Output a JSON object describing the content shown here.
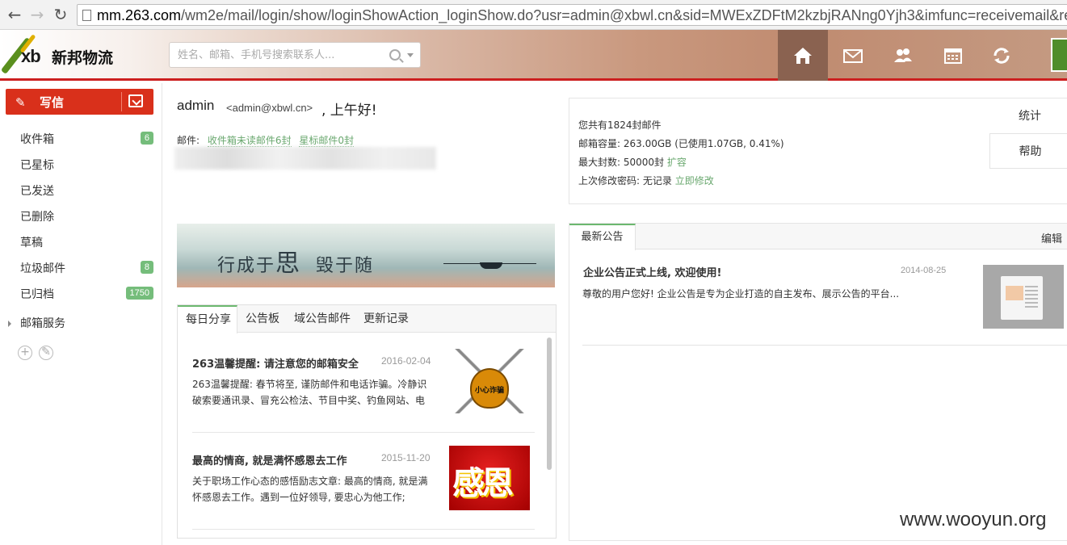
{
  "browser": {
    "url_host": "mm.263.com",
    "url_path": "/wm2e/mail/login/show/loginShowAction_loginShow.do?usr=admin@xbwl.cn&sid=MWExZDFtM2kzbjRANng0Yjh3&imfunc=receivemail&rece"
  },
  "header": {
    "logo_mark": "xb",
    "logo_name": "新邦物流",
    "search_placeholder": "姓名、邮箱、手机号搜索联系人..."
  },
  "sidebar": {
    "compose_label": "写信",
    "folders": [
      {
        "label": "收件箱",
        "count": "6"
      },
      {
        "label": "已星标",
        "count": ""
      },
      {
        "label": "已发送",
        "count": ""
      },
      {
        "label": "已删除",
        "count": ""
      },
      {
        "label": "草稿",
        "count": ""
      },
      {
        "label": "垃圾邮件",
        "count": "8"
      },
      {
        "label": "已归档",
        "count": "1750"
      }
    ],
    "services_label": "邮箱服务"
  },
  "greeting": {
    "name": "admin",
    "email": "<admin@xbwl.cn>",
    "hello": ", 上午好!",
    "mail_label": "邮件:",
    "unread_link": "收件箱未读邮件6封",
    "starred_link": "星标邮件0封"
  },
  "banner": {
    "text_a": "行成于",
    "text_big": "思",
    "text_b": "毁于随"
  },
  "tabs": [
    "每日分享",
    "公告板",
    "域公告邮件",
    "更新记录"
  ],
  "articles": [
    {
      "title": "263温馨提醒: 请注意您的邮箱安全",
      "date": "2016-02-04",
      "body": "263温馨提醒: 春节将至, 谨防邮件和电话诈骗。冷静识破索要通讯录、冒充公检法、节目中奖、钓鱼网站、电",
      "thumb_text": "小心诈骗"
    },
    {
      "title": "最高的情商, 就是满怀感恩去工作",
      "date": "2015-11-20",
      "body": "关于职场工作心态的感悟励志文章: 最高的情商, 就是满怀感恩去工作。遇到一位好领导, 要忠心为他工作;",
      "thumb_text": "感恩"
    }
  ],
  "stats": {
    "total": "您共有1824封邮件",
    "capacity": "邮箱容量: 263.00GB (已使用1.07GB, 0.41%)",
    "max_count": "最大封数: 50000封",
    "expand_link": "扩容",
    "last_pwd": "上次修改密码: 无记录",
    "change_link": "立即修改",
    "btn_stats": "统计",
    "btn_help": "帮助"
  },
  "notice": {
    "tab_label": "最新公告",
    "edit_label": "编辑",
    "title": "企业公告正式上线, 欢迎使用!",
    "date": "2014-08-25",
    "body": "尊敬的用户您好! 企业公告是专为企业打造的自主发布、展示公告的平台..."
  },
  "watermark": "www.wooyun.org",
  "colors": {
    "accent_red": "#d9301b",
    "accent_green": "#6cb86f",
    "badge_green": "#75bd7b"
  }
}
